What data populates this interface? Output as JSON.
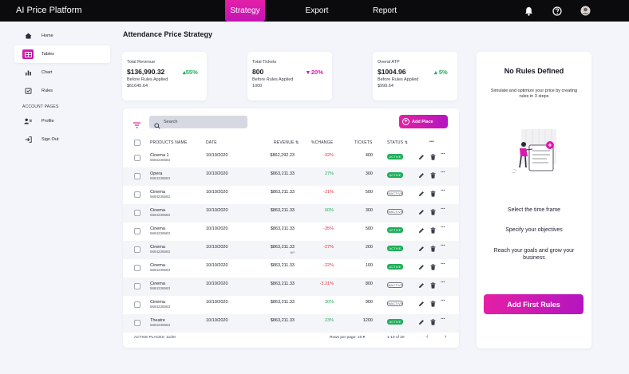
{
  "app": {
    "title": "AI Price Platform"
  },
  "topnav": {
    "strategy": "Strategy",
    "export": "Export",
    "report": "Report"
  },
  "sidebar": {
    "items": [
      {
        "label": "Home",
        "icon": "home-icon"
      },
      {
        "label": "Tables",
        "icon": "tables-icon"
      },
      {
        "label": "Chart",
        "icon": "chart-icon"
      },
      {
        "label": "Rules",
        "icon": "rules-icon"
      }
    ],
    "section": "ACCOUNT PAGES",
    "account_items": [
      {
        "label": "Profile",
        "icon": "profile-icon"
      },
      {
        "label": "Sign Out",
        "icon": "sign-out-icon"
      }
    ]
  },
  "page": {
    "title": "Attendance Price Strategy"
  },
  "stats": [
    {
      "label": "Total Revenue",
      "value": "$136,990.32",
      "change": "55%",
      "direction": "up",
      "sub_label": "Before Rules Applied",
      "sub_value": "$61645.64"
    },
    {
      "label": "Total Tickets",
      "value": "800",
      "change": "20%",
      "direction": "down",
      "sub_label": "Before Rules Applied",
      "sub_value": "1000"
    },
    {
      "label": "Overal ATP",
      "value": "$1004.96",
      "change": "5%",
      "direction": "up",
      "sub_label": "Before Rules Applied",
      "sub_value": "$999.64"
    }
  ],
  "table": {
    "search_placeholder": "Search",
    "add_label": "Add Place",
    "headers": {
      "name": "PRODUCTS NAME",
      "date": "DATE",
      "revenue": "REVENUE",
      "change": "%CHANGE",
      "tickets": "TICKETS",
      "status": "STATUS",
      "more": "•••"
    },
    "rows": [
      {
        "name": "Cinema 1",
        "id": "5684236583",
        "date": "10/10/2020",
        "revenue": "$862,292.23",
        "revenue_note": "",
        "change": "-32%",
        "change_dir": "neg",
        "tickets": "400",
        "status": "ACTIVE"
      },
      {
        "name": "Opera",
        "id": "5684236583",
        "date": "10/10/2020",
        "revenue": "$863,211.33",
        "revenue_note": "",
        "change": "27%",
        "change_dir": "pos",
        "tickets": "300",
        "status": "ACTIVE"
      },
      {
        "name": "Cinema",
        "id": "5684236583",
        "date": "10/10/2020",
        "revenue": "$863,211.33",
        "revenue_note": "",
        "change": "-21%",
        "change_dir": "neg",
        "tickets": "500",
        "status": "INACTIVE"
      },
      {
        "name": "Cinema",
        "id": "5684236583",
        "date": "10/10/2020",
        "revenue": "$863,211.33",
        "revenue_note": "",
        "change": "60%",
        "change_dir": "pos",
        "tickets": "300",
        "status": "INACTIVE"
      },
      {
        "name": "Cinema",
        "id": "5684236583",
        "date": "10/10/2020",
        "revenue": "$863,211.33",
        "revenue_note": "",
        "change": "-35%",
        "change_dir": "neg",
        "tickets": "500",
        "status": "ACTIVE"
      },
      {
        "name": "Cinema",
        "id": "5684236583",
        "date": "10/10/2020",
        "revenue": "$863,211.33",
        "revenue_note": "NR",
        "change": "-27%",
        "change_dir": "neg",
        "tickets": "200",
        "status": "ACTIVE"
      },
      {
        "name": "Cinema",
        "id": "5684236583",
        "date": "10/10/2020",
        "revenue": "$863,211.33",
        "revenue_note": "",
        "change": "-22%",
        "change_dir": "neg",
        "tickets": "100",
        "status": "ACTIVE"
      },
      {
        "name": "Cinema",
        "id": "5684236583",
        "date": "10/10/2020",
        "revenue": "$863,211.33",
        "revenue_note": "",
        "change": "-3.21%",
        "change_dir": "neg",
        "tickets": "800",
        "status": "INACTIVE"
      },
      {
        "name": "Cinema",
        "id": "5684236583",
        "date": "10/10/2020",
        "revenue": "$863,211.33",
        "revenue_note": "",
        "change": "30%",
        "change_dir": "pos",
        "tickets": "900",
        "status": "INACTIVE"
      },
      {
        "name": "Theatre",
        "id": "5684236583",
        "date": "10/10/2020",
        "revenue": "$863,211.33",
        "revenue_note": "",
        "change": "23%",
        "change_dir": "pos",
        "tickets": "1200",
        "status": "ACTIVE"
      }
    ],
    "footer": {
      "active_places": "ACTIVE PLACES: 11/20",
      "rows_per_page": "Rows per page: 10",
      "range": "1-10 of 20"
    }
  },
  "rules_panel": {
    "title": "No Rules Defined",
    "subtitle": "Simulate and optimize your price by creating rules in 3 steps",
    "steps": [
      "Select the time frame",
      "Specify your objectives",
      "Reach your goals and grow your business"
    ],
    "button": "Add First Rules"
  },
  "colors": {
    "accent": "#d81aad",
    "positive": "#1fae5a",
    "negative": "#e0323c",
    "topbar": "#0b0b0d"
  }
}
